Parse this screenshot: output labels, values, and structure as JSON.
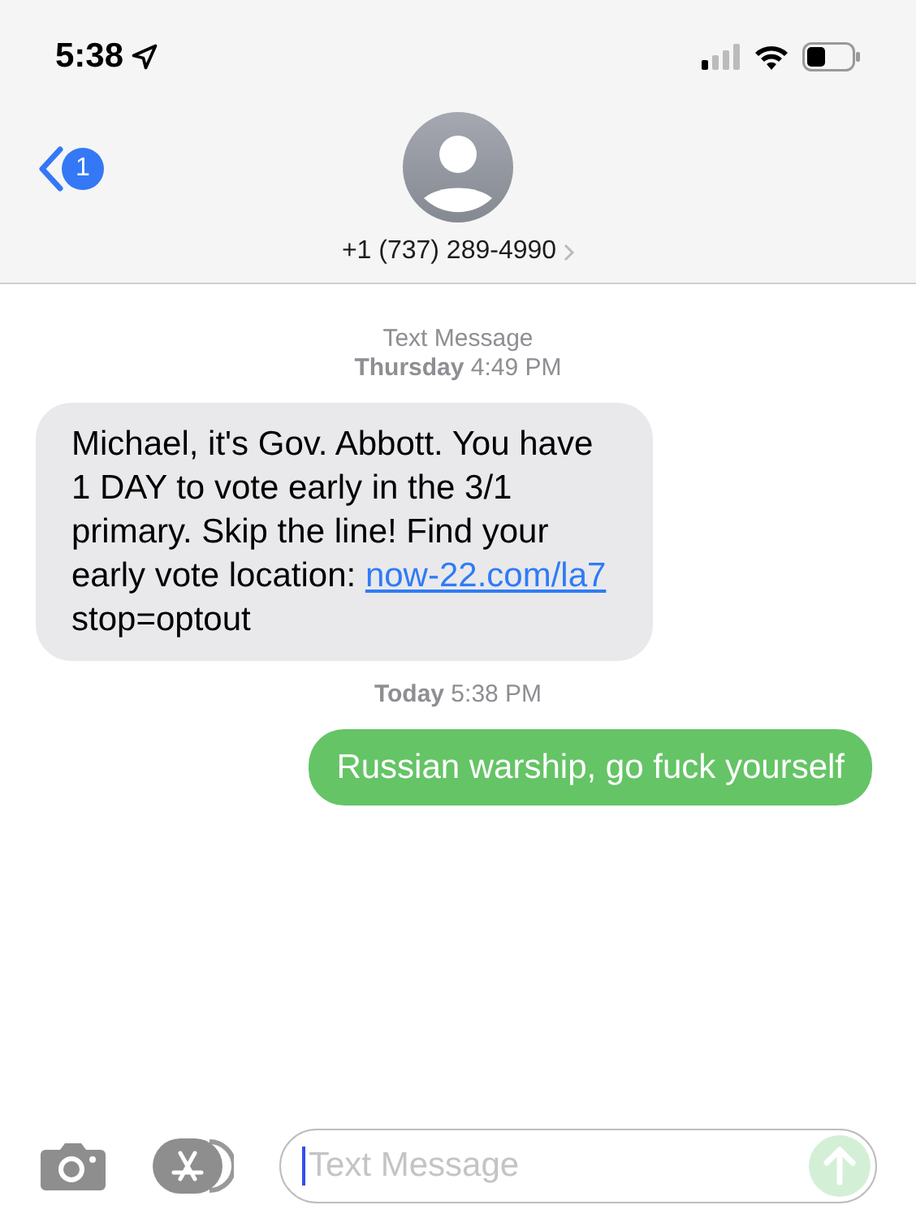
{
  "status_bar": {
    "time": "5:38"
  },
  "header": {
    "back_badge": "1",
    "contact": "+1 (737) 289-4990"
  },
  "thread": [
    {
      "kind": "timestamp",
      "label": "Text Message",
      "time": "Thursday 4:49 PM"
    },
    {
      "kind": "incoming",
      "text_before": "Michael, it's Gov. Abbott. You have 1 DAY to vote early in the 3/1 primary. Skip the line! Find your early vote location: ",
      "link": "now-22.com/la7",
      "text_after": " stop=optout"
    },
    {
      "kind": "timestamp",
      "time": "Today 5:38 PM"
    },
    {
      "kind": "outgoing",
      "text": "Russian warship, go fuck yourself"
    }
  ],
  "composer": {
    "placeholder": "Text Message"
  }
}
